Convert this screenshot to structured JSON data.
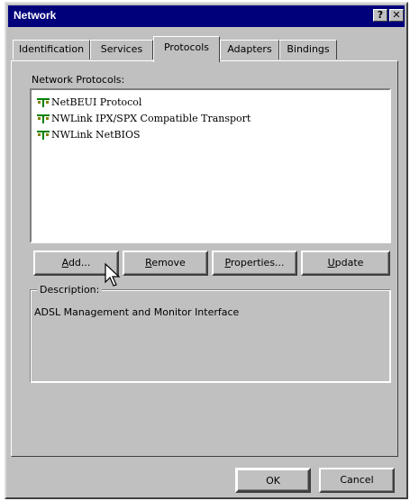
{
  "window": {
    "title": "Network",
    "help_glyph": "?",
    "close_glyph": "✕"
  },
  "tabs": [
    {
      "label": "Identification"
    },
    {
      "label": "Services"
    },
    {
      "label": "Protocols",
      "active": true
    },
    {
      "label": "Adapters"
    },
    {
      "label": "Bindings"
    }
  ],
  "protocols": {
    "label": "Network Protocols:",
    "items": [
      {
        "name": "NetBEUI Protocol",
        "icon": "network-protocol-icon"
      },
      {
        "name": "NWLink IPX/SPX Compatible Transport",
        "icon": "network-protocol-icon"
      },
      {
        "name": "NWLink NetBIOS",
        "icon": "network-protocol-icon"
      }
    ]
  },
  "buttons": {
    "add": {
      "first": "A",
      "rest": "dd..."
    },
    "remove": {
      "first": "R",
      "rest": "emove"
    },
    "properties": {
      "first": "P",
      "rest": "roperties..."
    },
    "update": {
      "first": "U",
      "rest": "pdate"
    }
  },
  "description": {
    "legend": "Description:",
    "text": "ADSL Management and Monitor Interface"
  },
  "footer": {
    "ok": "OK",
    "cancel": "Cancel"
  },
  "colors": {
    "face": "#c0c0c0",
    "titlebar": "#00007b",
    "list_bg": "#ffffff"
  }
}
